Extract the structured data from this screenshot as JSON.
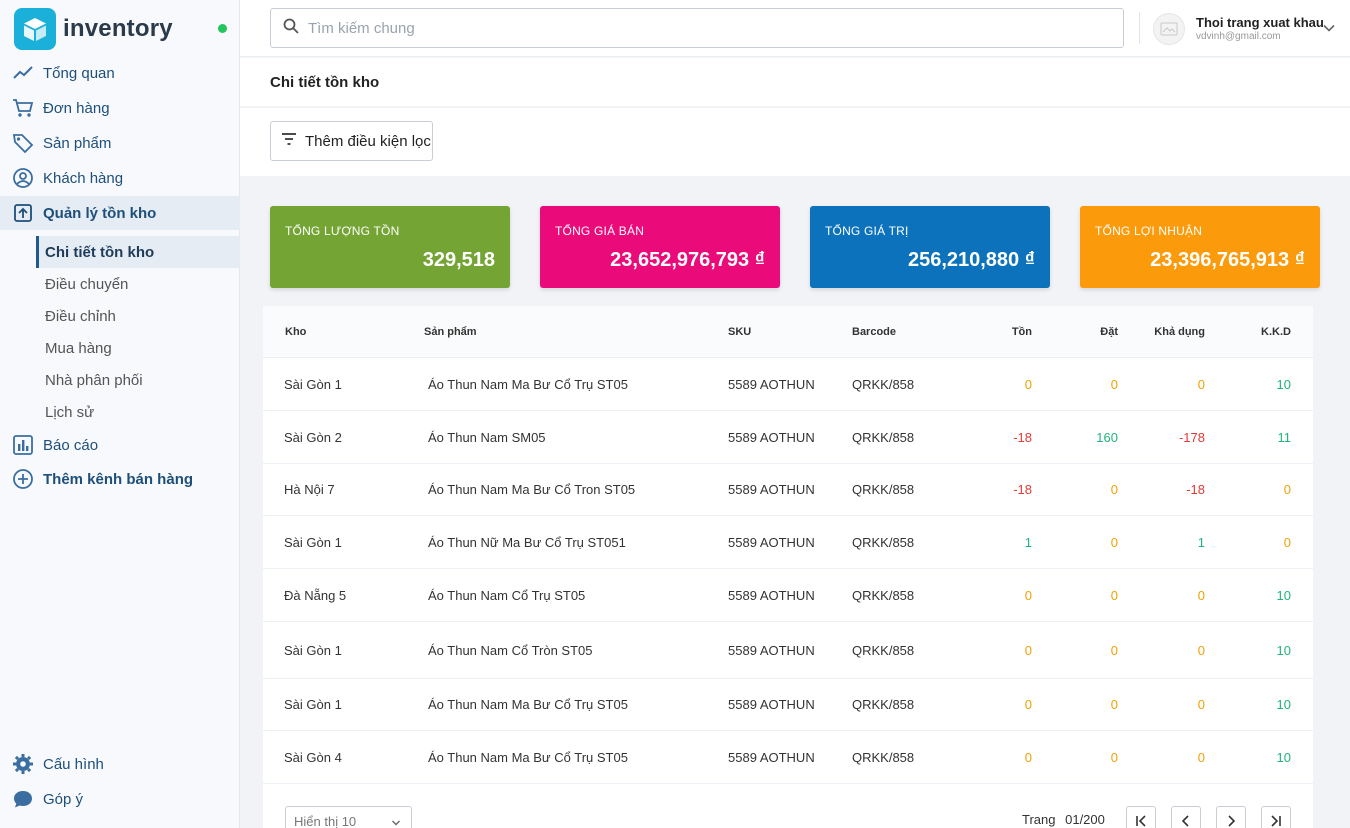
{
  "brand": {
    "name": "inventory"
  },
  "sidebar": {
    "items": [
      {
        "label": "Tổng quan",
        "icon": "trend-icon"
      },
      {
        "label": "Đơn hàng",
        "icon": "cart-icon"
      },
      {
        "label": "Sản phẩm",
        "icon": "tag-icon"
      },
      {
        "label": "Khách hàng",
        "icon": "user-circle-icon"
      },
      {
        "label": "Quản lý tồn kho",
        "icon": "inventory-box-icon"
      },
      {
        "label": "Báo cáo",
        "icon": "bar-chart-icon"
      },
      {
        "label": "Thêm kênh bán hàng",
        "icon": "plus-circle-icon"
      }
    ],
    "sub_items": [
      {
        "label": "Chi tiết tồn kho"
      },
      {
        "label": "Điều chuyển"
      },
      {
        "label": "Điều chỉnh"
      },
      {
        "label": "Mua hàng"
      },
      {
        "label": "Nhà phân phối"
      },
      {
        "label": "Lịch sử"
      }
    ],
    "bottom_items": [
      {
        "label": "Cấu hình",
        "icon": "gear-icon"
      },
      {
        "label": "Góp ý",
        "icon": "chat-bubble-icon"
      }
    ]
  },
  "search": {
    "placeholder": "Tìm kiếm chung"
  },
  "user": {
    "name": "Thoi trang xuat khau",
    "email": "vdvinh@gmail.com"
  },
  "page": {
    "title": "Chi tiết tồn kho",
    "filter_button": "Thêm điều kiện lọc"
  },
  "stats": [
    {
      "label": "TỔNG LƯỢNG TỒN",
      "value": "329,518",
      "color": "#74a534"
    },
    {
      "label": "TỔNG GIÁ BÁN",
      "value": "23,652,976,793 ₫",
      "color": "#ea0a7a"
    },
    {
      "label": "TỔNG GIÁ TRỊ",
      "value": "256,210,880 ₫",
      "color": "#0b72bb"
    },
    {
      "label": "TỔNG LỢI NHUẬN",
      "value": "23,396,765,913 ₫",
      "color": "#fb9a0a"
    }
  ],
  "table": {
    "headers": [
      "Kho",
      "Sản phẩm",
      "SKU",
      "Barcode",
      "Tồn",
      "Đặt",
      "Khả dụng",
      "K.K.D"
    ],
    "rows": [
      {
        "kho": "Sài Gòn 1",
        "san_pham": "Áo Thun Nam Ma Bư Cổ Trụ ST05",
        "sku": "5589 AOTHUN",
        "barcode": "QRKK/858",
        "ton": "0",
        "dat": "0",
        "kha_dung": "0",
        "kkd": "10"
      },
      {
        "kho": "Sài Gòn 2",
        "san_pham": "Áo Thun Nam  SM05",
        "sku": "5589 AOTHUN",
        "barcode": "QRKK/858",
        "ton": "-18",
        "dat": "160",
        "kha_dung": "-178",
        "kkd": "11"
      },
      {
        "kho": "Hà Nội 7",
        "san_pham": "Áo Thun Nam Ma Bư Cổ Tron ST05",
        "sku": "5589 AOTHUN",
        "barcode": "QRKK/858",
        "ton": "-18",
        "dat": "0",
        "kha_dung": "-18",
        "kkd": "0"
      },
      {
        "kho": "Sài Gòn 1",
        "san_pham": "Áo Thun Nữ Ma Bư Cổ Trụ ST051",
        "sku": "5589 AOTHUN",
        "barcode": "QRKK/858",
        "ton": "1",
        "dat": "0",
        "kha_dung": "1",
        "kkd": "0"
      },
      {
        "kho": "Đà Nẵng 5",
        "san_pham": "Áo Thun Nam  Cổ Trụ ST05",
        "sku": "5589 AOTHUN",
        "barcode": "QRKK/858",
        "ton": "0",
        "dat": "0",
        "kha_dung": "0",
        "kkd": "10"
      },
      {
        "kho": "Sài Gòn 1",
        "san_pham": "Áo Thun Nam Cổ Tròn ST05",
        "sku": "5589 AOTHUN",
        "barcode": "QRKK/858",
        "ton": "0",
        "dat": "0",
        "kha_dung": "0",
        "kkd": "10"
      },
      {
        "kho": "Sài Gòn 1",
        "san_pham": "Áo Thun Nam Ma Bư Cổ Trụ ST05",
        "sku": "5589 AOTHUN",
        "barcode": "QRKK/858",
        "ton": "0",
        "dat": "0",
        "kha_dung": "0",
        "kkd": "10"
      },
      {
        "kho": "Sài Gòn 4",
        "san_pham": "Áo Thun Nam Ma Bư Cổ Trụ ST05",
        "sku": "5589 AOTHUN",
        "barcode": "QRKK/858",
        "ton": "0",
        "dat": "0",
        "kha_dung": "0",
        "kkd": "10"
      }
    ]
  },
  "pagination": {
    "page_size": "Hiển thị 10",
    "page_label": "Trang",
    "current": "01/200"
  },
  "colors": {
    "orange": "#f0a202",
    "red": "#e53935",
    "green": "#1fb57a",
    "accent": "#1e4f7a"
  }
}
